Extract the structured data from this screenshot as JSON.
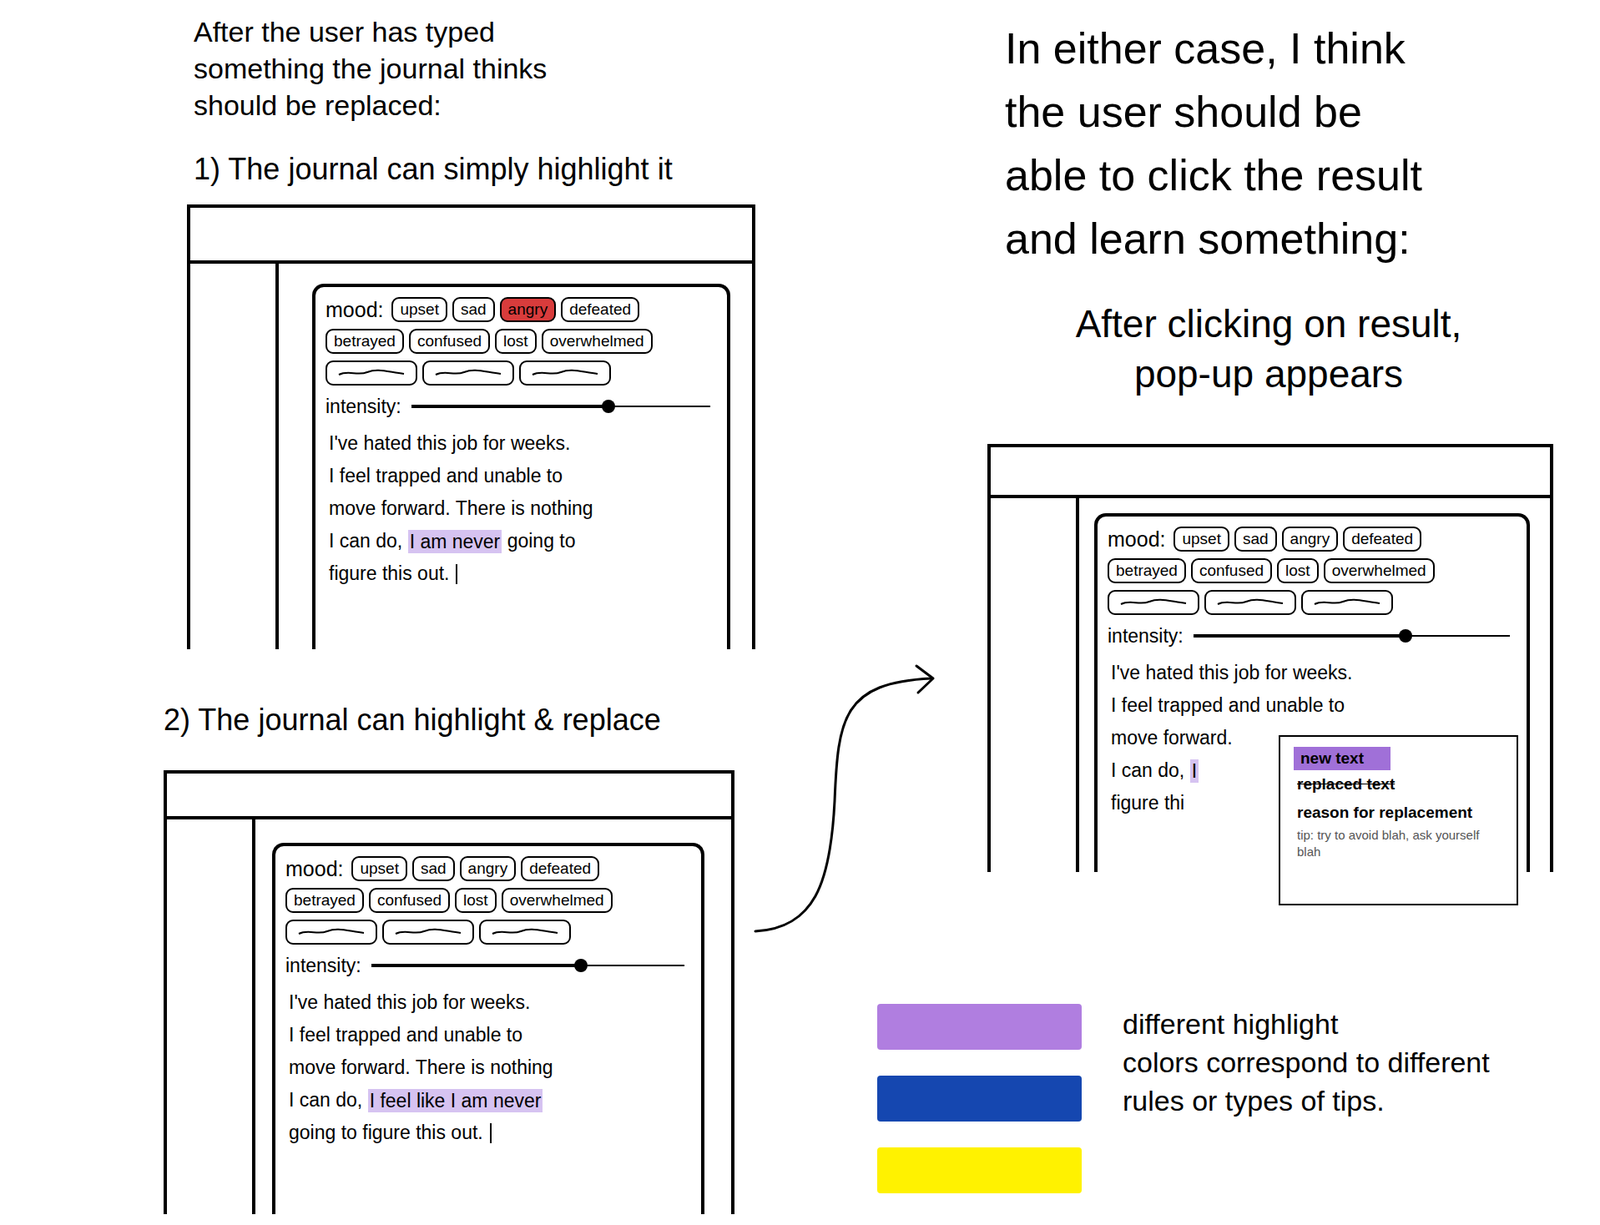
{
  "notes": {
    "intro": [
      "After the user has typed",
      "something the journal thinks",
      "should be replaced:"
    ],
    "option_1": "1) The journal can simply highlight it",
    "option_2": "2) The journal can highlight & replace",
    "click_note": [
      "In either case, I think",
      "the user should be",
      "able to click the result",
      "and learn something:"
    ],
    "popup_note": [
      "After clicking on result,",
      "pop-up appears"
    ]
  },
  "windows": [
    {
      "mood_label": "mood:",
      "tags": [
        {
          "kind": "word",
          "label": "upset",
          "selected": false
        },
        {
          "kind": "word",
          "label": "sad",
          "selected": false
        },
        {
          "kind": "word",
          "label": "angry",
          "selected": true
        },
        {
          "kind": "word",
          "label": "defeated",
          "selected": false
        },
        {
          "kind": "word",
          "label": "betrayed",
          "selected": false
        },
        {
          "kind": "word",
          "label": "confused",
          "selected": false
        },
        {
          "kind": "word",
          "label": "lost",
          "selected": false
        },
        {
          "kind": "word",
          "label": "overwhelmed",
          "selected": false
        },
        {
          "kind": "blank",
          "selected": false
        },
        {
          "kind": "blank",
          "selected": false
        },
        {
          "kind": "blank",
          "selected": false
        }
      ],
      "intensity_label": "intensity:",
      "level": 0.66,
      "lines": [
        [
          {
            "text": "I've hated this job for weeks."
          }
        ],
        [
          {
            "text": "I feel trapped and unable to"
          }
        ],
        [
          {
            "text": "move forward. There is nothing"
          }
        ],
        [
          {
            "text": "I can do, "
          },
          {
            "text": "I am never",
            "color": "#d6c3f1"
          },
          {
            "text": " going to"
          }
        ],
        [
          {
            "text": "figure this out."
          }
        ]
      ],
      "cursor": true
    },
    {
      "mood_label": "mood:",
      "tags": [
        {
          "kind": "word",
          "label": "upset",
          "selected": false
        },
        {
          "kind": "word",
          "label": "sad",
          "selected": false
        },
        {
          "kind": "word",
          "label": "angry",
          "selected": false
        },
        {
          "kind": "word",
          "label": "defeated",
          "selected": false
        },
        {
          "kind": "word",
          "label": "betrayed",
          "selected": false
        },
        {
          "kind": "word",
          "label": "confused",
          "selected": false
        },
        {
          "kind": "word",
          "label": "lost",
          "selected": false
        },
        {
          "kind": "word",
          "label": "overwhelmed",
          "selected": false
        },
        {
          "kind": "blank",
          "selected": false
        },
        {
          "kind": "blank",
          "selected": false
        },
        {
          "kind": "blank",
          "selected": false
        }
      ],
      "intensity_label": "intensity:",
      "level": 0.67,
      "lines": [
        [
          {
            "text": "I've hated this job for weeks."
          }
        ],
        [
          {
            "text": "I feel trapped and unable to"
          }
        ],
        [
          {
            "text": "move forward. There is nothing"
          }
        ],
        [
          {
            "text": "I can do, "
          },
          {
            "text": "I feel like I am never",
            "color": "#d6c3f1"
          }
        ],
        [
          {
            "text": "going to figure this out."
          }
        ]
      ],
      "cursor": true
    },
    {
      "mood_label": "mood:",
      "tags": [
        {
          "kind": "word",
          "label": "upset",
          "selected": false
        },
        {
          "kind": "word",
          "label": "sad",
          "selected": false
        },
        {
          "kind": "word",
          "label": "angry",
          "selected": false
        },
        {
          "kind": "word",
          "label": "defeated",
          "selected": false
        },
        {
          "kind": "word",
          "label": "betrayed",
          "selected": false
        },
        {
          "kind": "word",
          "label": "confused",
          "selected": false
        },
        {
          "kind": "word",
          "label": "lost",
          "selected": false
        },
        {
          "kind": "word",
          "label": "overwhelmed",
          "selected": false
        },
        {
          "kind": "blank",
          "selected": false
        },
        {
          "kind": "blank",
          "selected": false
        },
        {
          "kind": "blank",
          "selected": false
        }
      ],
      "intensity_label": "intensity:",
      "level": 0.67,
      "lines": [
        [
          {
            "text": "I've hated this job for weeks."
          }
        ],
        [
          {
            "text": "I feel trapped and unable to"
          }
        ],
        [
          {
            "text": "move forward."
          }
        ],
        [
          {
            "text": "I can do, "
          },
          {
            "text": "I",
            "color": "#d6c3f1"
          }
        ],
        [
          {
            "text": "figure thi"
          }
        ]
      ],
      "cursor": false,
      "popup": {
        "new_text": "new text",
        "replaced_text": "replaced text",
        "reason": "reason for replacement",
        "tip": "tip: try to avoid blah, ask yourself blah"
      }
    }
  ],
  "legend": {
    "swatches": [
      {
        "color": "#b07ee0"
      },
      {
        "color": "#1547b0"
      },
      {
        "color": "#fff200"
      }
    ],
    "text": [
      "different highlight",
      "colors correspond to different",
      "rules or types of tips."
    ]
  }
}
